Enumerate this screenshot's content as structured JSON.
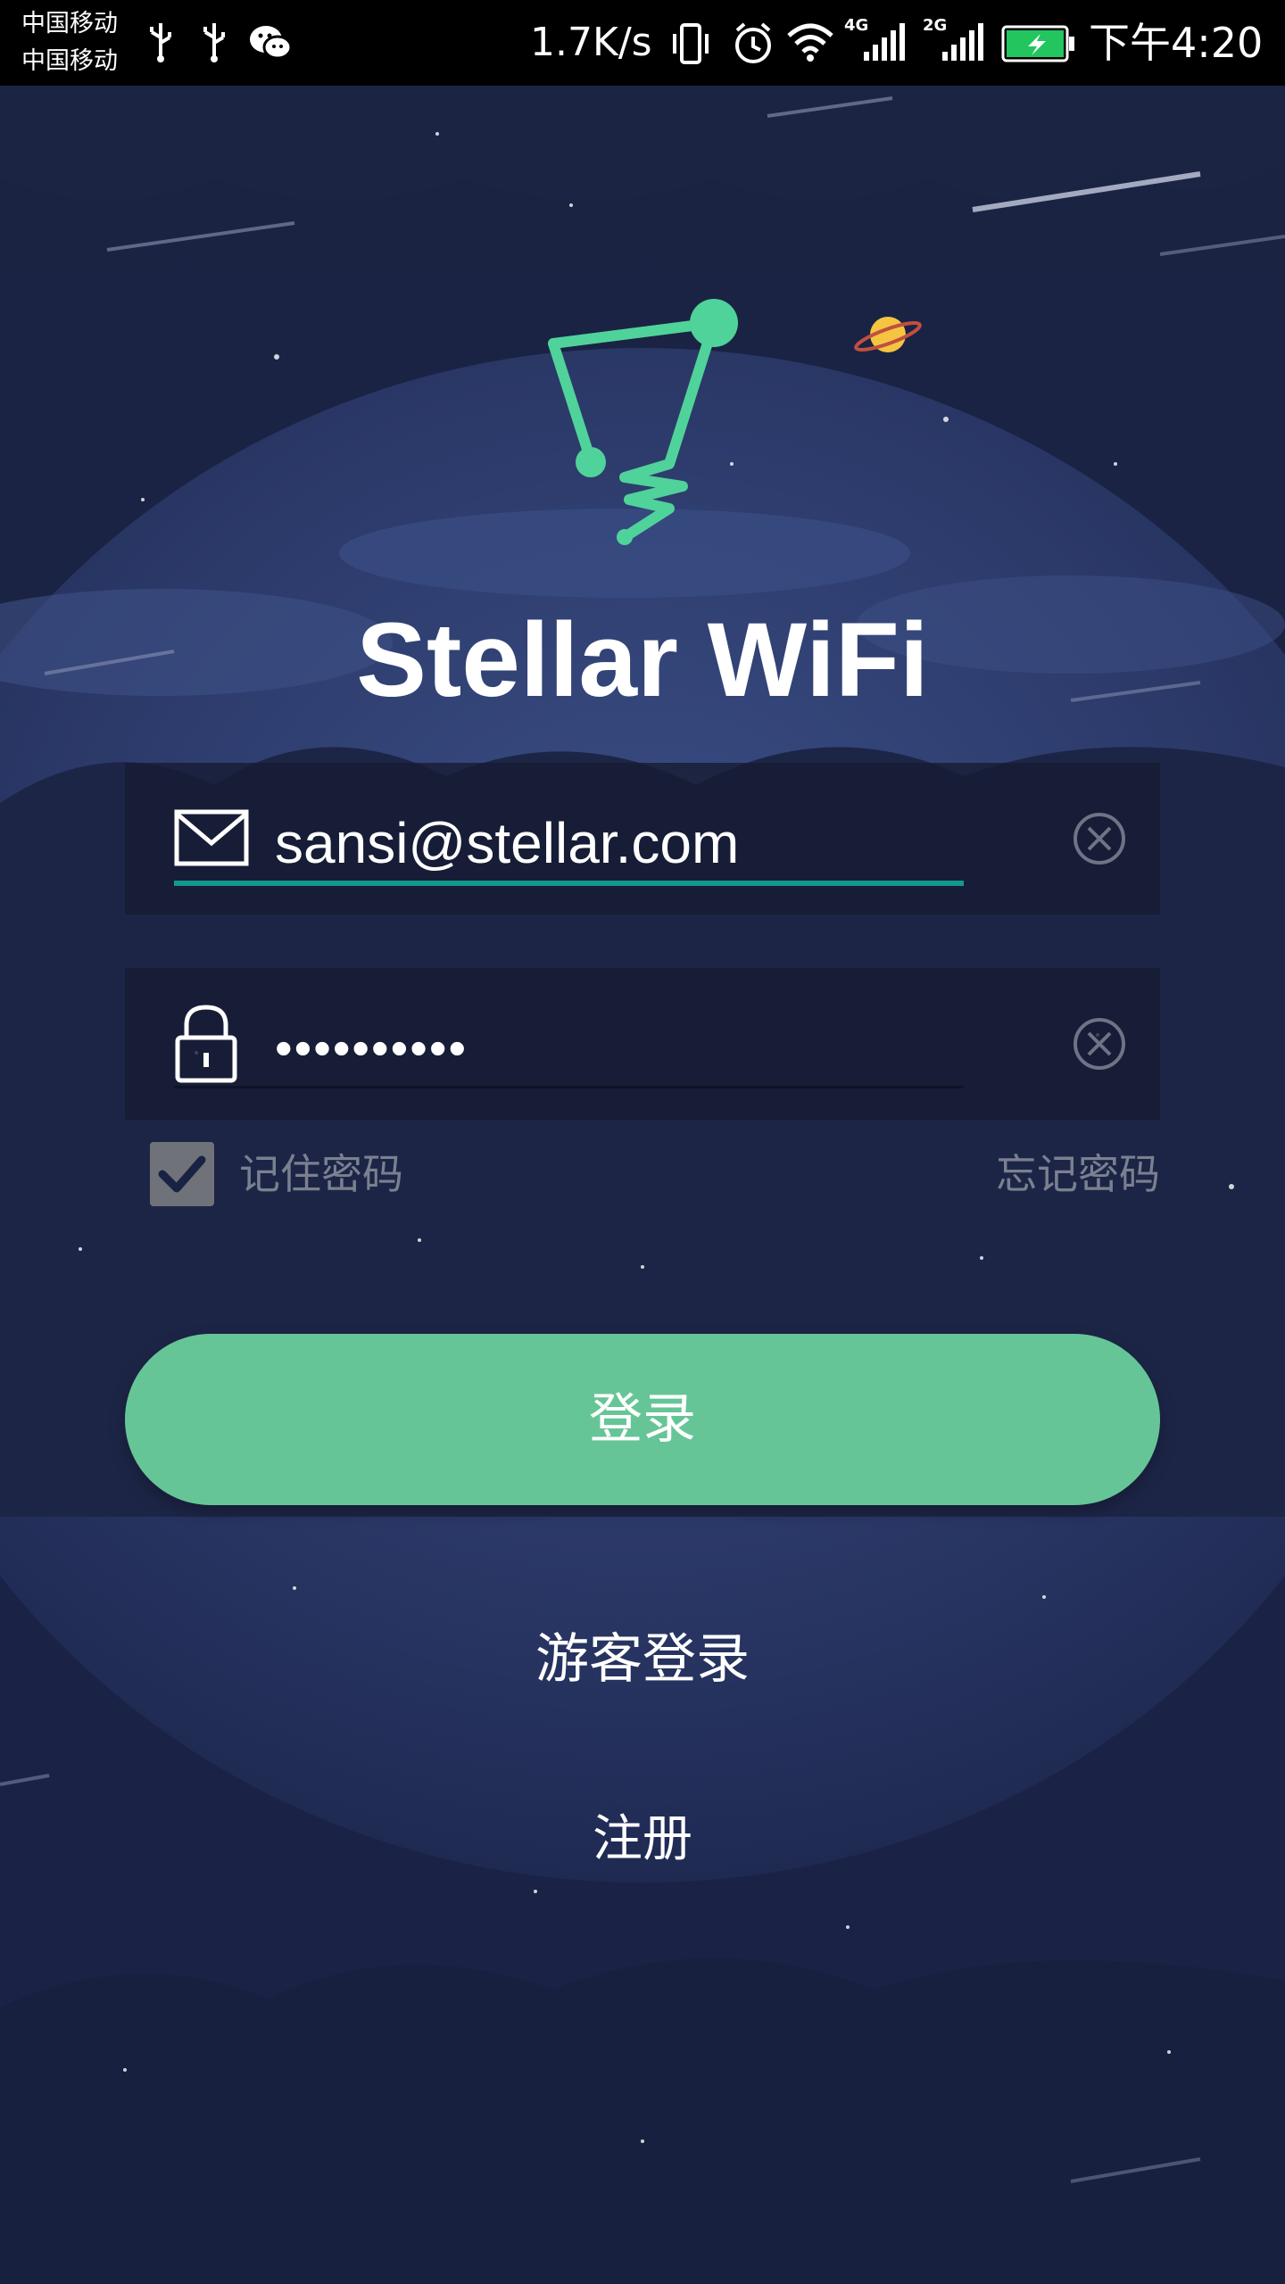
{
  "status_bar": {
    "carrier_1": "中国移动",
    "carrier_2": "中国移动",
    "net_speed": "1.7K/s",
    "network_1": "4G",
    "network_2": "2G",
    "time": "下午4:20",
    "icons": [
      "usb-icon",
      "usb-icon",
      "wechat-icon",
      "vibrate-icon",
      "alarm-icon",
      "wifi-icon",
      "signal-icon",
      "signal-icon",
      "battery-charging-icon"
    ]
  },
  "app": {
    "title": "Stellar WiFi",
    "logo_color": "#4fd39a",
    "background_color": "#1a2244"
  },
  "login_form": {
    "email_value": "sansi@stellar.com",
    "password_value": "••••••••••",
    "remember_label": "记住密码",
    "remember_checked": true,
    "forgot_label": "忘记密码",
    "login_button_label": "登录",
    "login_button_color": "#66c597",
    "guest_login_label": "游客登录",
    "register_label": "注册",
    "active_underline_color": "#13998c"
  }
}
